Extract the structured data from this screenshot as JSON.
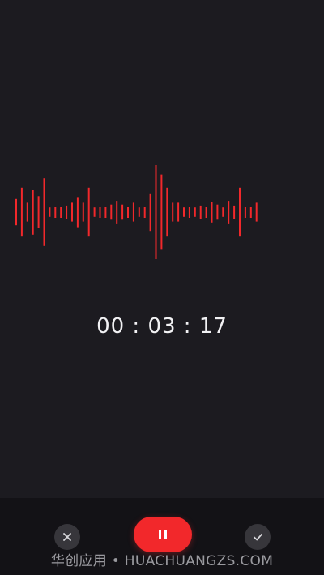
{
  "recording": {
    "elapsed_time": "00 : 03 : 17",
    "waveform_color": "#f2282b",
    "waveform_levels": [
      0.28,
      0.52,
      0.2,
      0.48,
      0.34,
      0.72,
      0.1,
      0.12,
      0.12,
      0.14,
      0.2,
      0.32,
      0.2,
      0.52,
      0.1,
      0.12,
      0.12,
      0.16,
      0.24,
      0.16,
      0.12,
      0.2,
      0.1,
      0.12,
      0.4,
      1.0,
      0.8,
      0.52,
      0.2,
      0.2,
      0.1,
      0.12,
      0.1,
      0.14,
      0.12,
      0.22,
      0.16,
      0.1,
      0.24,
      0.14,
      0.52,
      0.12,
      0.12,
      0.2
    ]
  },
  "controls": {
    "cancel_icon": "close-icon",
    "pause_icon": "pause-icon",
    "confirm_icon": "checkmark-icon",
    "accent_color": "#f2282b"
  },
  "watermark": {
    "text": "华创应用 • HUACHUANGZS.COM"
  }
}
